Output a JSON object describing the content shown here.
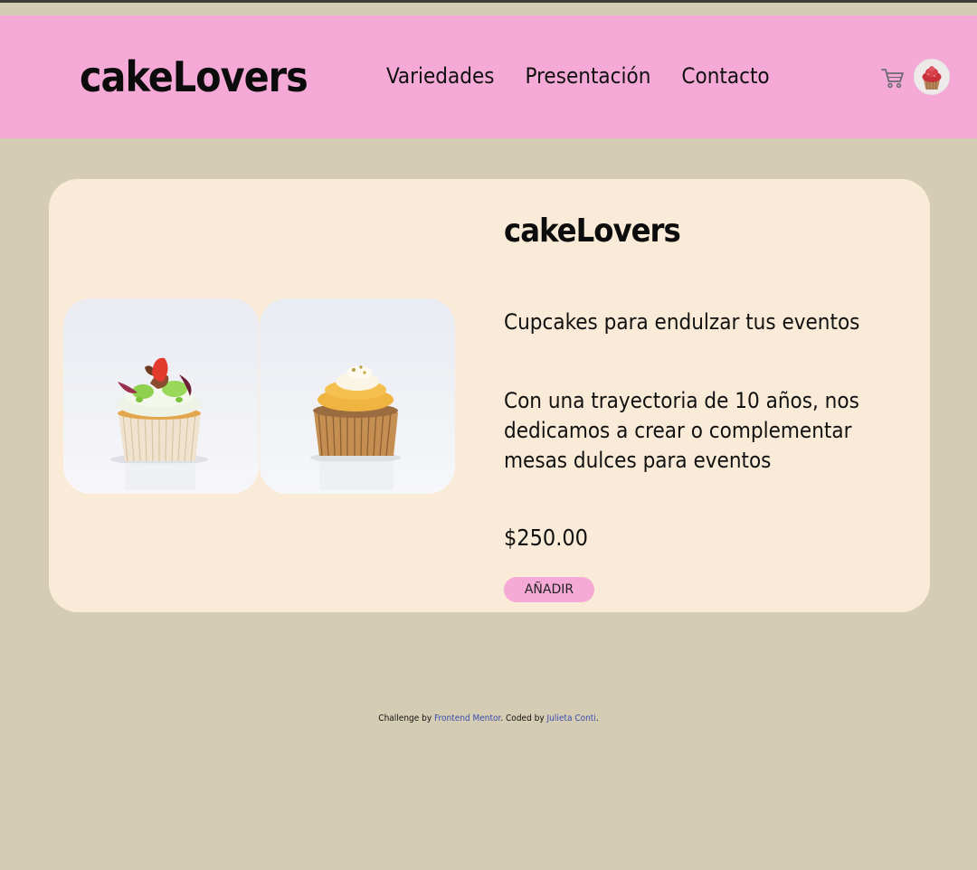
{
  "brand": {
    "logo": "cakeLovers"
  },
  "nav": {
    "items": [
      "Variedades",
      "Presentación",
      "Contacto"
    ]
  },
  "icons": {
    "cart": "cart-icon",
    "avatar": "cupcake-avatar"
  },
  "product": {
    "title": "cakeLovers",
    "subtitle": "Cupcakes para endulzar tus eventos",
    "description": "Con una trayectoria de 10 años, nos dedicamos a crear o complementar mesas dulces para eventos",
    "price": "$250.00",
    "add_label": "AÑADIR",
    "images": [
      "strawberry-cupcake",
      "vanilla-cupcake"
    ]
  },
  "footer": {
    "prefix": "Challenge by",
    "link1": "Frontend Mentor",
    "middle": ". Coded by",
    "link2": "Julieta Conti",
    "suffix": "."
  },
  "colors": {
    "page_bg": "#d5cdb3",
    "header_bg": "#f4a9d6",
    "card_bg": "#f9ebd7",
    "button_bg": "#f4a9d6",
    "link": "#3a4bb0"
  }
}
